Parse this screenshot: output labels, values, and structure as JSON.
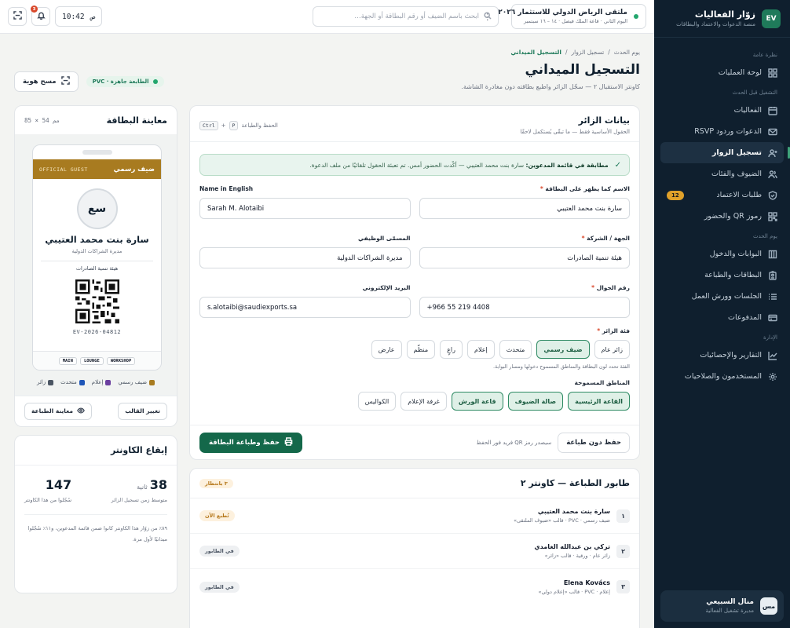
{
  "brand": {
    "logo": "EV",
    "title": "زوّار الفعاليات",
    "subtitle": "منصة الدعوات والاعتماد والبطاقات"
  },
  "nav": {
    "sections": [
      {
        "title": "نظرة عامة",
        "items": [
          {
            "label": "لوحة العمليات",
            "icon": "grid-icon"
          }
        ]
      },
      {
        "title": "التشغيل قبل الحدث",
        "items": [
          {
            "label": "الفعاليات",
            "icon": "calendar-icon"
          },
          {
            "label": "الدعوات وردود RSVP",
            "icon": "mail-icon"
          },
          {
            "label": "تسجيل الزوار",
            "icon": "user-plus-icon",
            "active": true
          },
          {
            "label": "الضيوف والفئات",
            "icon": "users-icon"
          },
          {
            "label": "طلبات الاعتماد",
            "icon": "shield-icon",
            "badge": "12"
          },
          {
            "label": "رموز QR والحضور",
            "icon": "qr-icon"
          }
        ]
      },
      {
        "title": "يوم الحدث",
        "items": [
          {
            "label": "البوابات والدخول",
            "icon": "gate-icon"
          },
          {
            "label": "البطاقات والطباعة",
            "icon": "badge-icon"
          },
          {
            "label": "الجلسات وورش العمل",
            "icon": "list-icon"
          },
          {
            "label": "المدفوعات",
            "icon": "card-icon"
          }
        ]
      },
      {
        "title": "الإدارة",
        "items": [
          {
            "label": "التقارير والإحصائيات",
            "icon": "chart-icon"
          },
          {
            "label": "المستخدمون والصلاحيات",
            "icon": "gear-icon"
          }
        ]
      }
    ]
  },
  "user": {
    "initials": "مس",
    "name": "منال السبيعي",
    "role": "مديرة تشغيل الفعالية"
  },
  "topbar": {
    "event_title": "ملتقى الرياض الدولي للاستثمار ٢٠٢٦",
    "event_sub": "اليوم الثاني · قاعة الملك فيصل · ١٤ – ١٦ سبتمبر",
    "search_placeholder": "ابحث باسم الضيف أو رقم البطاقة أو الجهة…",
    "clock_time": "10:42",
    "clock_period": "ص",
    "notif_count": "3"
  },
  "page": {
    "breadcrumb": [
      "يوم الحدث",
      "تسجيل الزوار",
      "التسجيل الميداني"
    ],
    "title": "التسجيل الميداني",
    "subtitle": "كاونتر الاستقبال ٢ — سجّل الزائر واطبع بطاقته دون مغادرة الشاشة.",
    "printer_status": "الطابعة جاهزة · PVC",
    "scan_button": "مسح هوية"
  },
  "form": {
    "title": "بيانات الزائر",
    "subtitle": "الحقول الأساسية فقط — ما تبقّى يُستكمل لاحقًا",
    "shortcut_label": "الحفظ والطباعة",
    "shortcut_keys": [
      "Ctrl",
      "P"
    ],
    "match_title": "مطابقة في قائمة المدعوين:",
    "match_text": "سارة بنت محمد العتيبي — أكّدت الحضور أمس. تم تعبئة الحقول تلقائيًا من ملف الدعوة.",
    "fields": {
      "name_ar": {
        "label": "الاسم كما يظهر على البطاقة",
        "value": "سارة بنت محمد العتيبي"
      },
      "name_en": {
        "label": "Name in English",
        "value": "Sarah M. Alotaibi"
      },
      "org": {
        "label": "الجهة / الشركة",
        "value": "هيئة تنمية الصادرات"
      },
      "job": {
        "label": "المسمّى الوظيفي",
        "value": "مديرة الشراكات الدولية"
      },
      "phone": {
        "label": "رقم الجوال",
        "value": "+966  55  219  4408"
      },
      "email": {
        "label": "البريد الإلكتروني",
        "value": "s.alotaibi@saudiexports.sa"
      }
    },
    "category_label": "فئة الزائر",
    "categories": [
      "زائر عام",
      "ضيف رسمي",
      "متحدث",
      "إعلام",
      "راعٍ",
      "منظّم",
      "عارض"
    ],
    "category_selected": 1,
    "category_hint": "الفئة تحدد لون البطاقة والمناطق المسموح دخولها ومسار البوابة.",
    "zones_label": "المناطق المسموحة",
    "zones": [
      {
        "label": "القاعة الرئيسية",
        "selected": true
      },
      {
        "label": "صالة الضيوف",
        "selected": true
      },
      {
        "label": "قاعة الورش",
        "selected": true
      },
      {
        "label": "غرفة الإعلام",
        "selected": false
      },
      {
        "label": "الكواليس",
        "selected": false
      }
    ],
    "save_no_print": "حفظ دون طباعة",
    "save_note": "سيصدر رمز QR فريد فور الحفظ",
    "save_print": "حفظ وطباعة البطاقة"
  },
  "queue": {
    "title": "طابور الطباعة — كاونتر ٢",
    "badge": "٣ بانتظار",
    "items": [
      {
        "num": "١",
        "name": "سارة بنت محمد العتيبي",
        "meta": "ضيف رسمي · PVC · قالب «ضيوف الملتقى»",
        "status": "تُطبع الآن",
        "active": true
      },
      {
        "num": "٢",
        "name": "تركي بن عبدالله الغامدي",
        "meta": "زائر عام · ورقية · قالب «زائر»",
        "status": "في الطابور",
        "active": false
      },
      {
        "num": "٣",
        "name": "Elena Kovács",
        "meta": "إعلام · PVC · قالب «إعلام دولي»",
        "status": "في الطابور",
        "active": false
      }
    ]
  },
  "preview": {
    "title": "معاينة البطاقة",
    "size": "85 × 54 مم",
    "badge_type": "ضيف رسمي",
    "badge_tag": "OFFICIAL GUEST",
    "initials": "سع",
    "name": "سارة بنت محمد العتيبي",
    "job": "مديرة الشراكات الدولية",
    "org": "هيئة تنمية الصادرات",
    "badge_id": "EV-2026-04812",
    "zones": [
      "MAIN",
      "LOUNGE",
      "WORKSHOP"
    ],
    "legend": [
      {
        "label": "ضيف رسمي",
        "color": "#a87b20"
      },
      {
        "label": "إعلام",
        "color": "#6b3fa0"
      },
      {
        "label": "متحدث",
        "color": "#1f56b8"
      },
      {
        "label": "زائر",
        "color": "#4b5563"
      }
    ],
    "change_template": "تغيير القالب",
    "print_preview": "معاينة الطباعة"
  },
  "rhythm": {
    "title": "إيقاع الكاونتر",
    "avg_value": "38",
    "avg_unit": "ثانية",
    "avg_label": "متوسط زمن تسجيل الزائر",
    "count_value": "147",
    "count_label": "سُجّلوا من هذا الكاونتر",
    "note": "٨٩٪ من زوّار هذا الكاونتر كانوا ضمن قائمة المدعوين، و١١٪ سُجّلوا ميدانيًا لأول مرة."
  }
}
